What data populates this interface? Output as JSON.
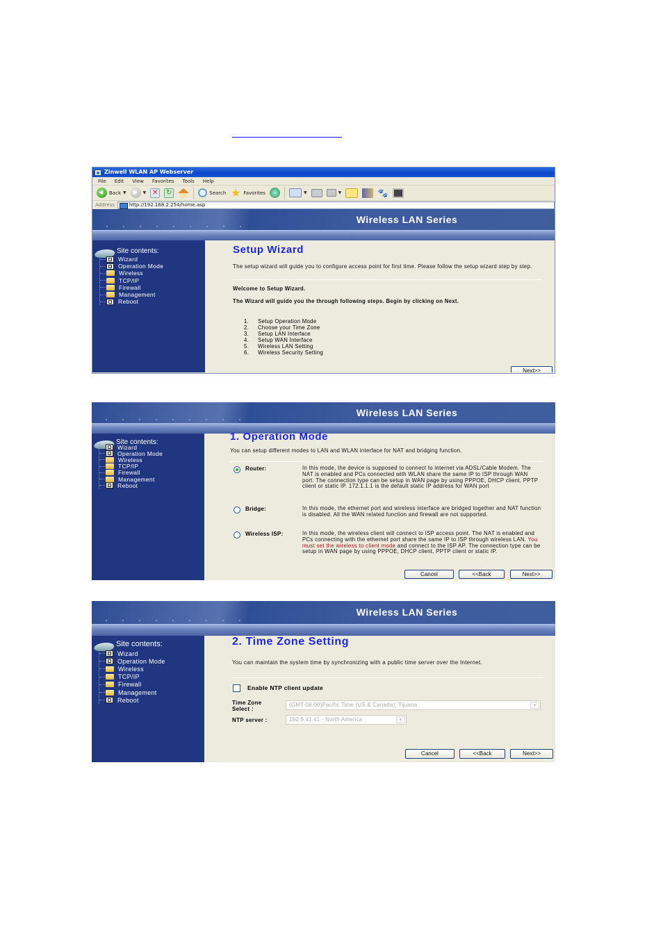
{
  "browser": {
    "window_title": "Zinwell WLAN AP Webserver",
    "menu": [
      "File",
      "Edit",
      "View",
      "Favorites",
      "Tools",
      "Help"
    ],
    "toolbar": {
      "back": "Back",
      "search": "Search",
      "favorites": "Favorites"
    },
    "address_label": "Address",
    "address_value": "http://192.168.2.254/home.asp"
  },
  "app": {
    "banner_title": "Wireless LAN Series",
    "sidebar": {
      "heading": "Site contents:",
      "items": [
        {
          "label": "Wizard",
          "icon": "page-icon"
        },
        {
          "label": "Operation Mode",
          "icon": "page-icon"
        },
        {
          "label": "Wireless",
          "icon": "folder-icon"
        },
        {
          "label": "TCP/IP",
          "icon": "folder-icon"
        },
        {
          "label": "Firewall",
          "icon": "folder-icon"
        },
        {
          "label": "Management",
          "icon": "folder-icon"
        },
        {
          "label": "Reboot",
          "icon": "page-icon"
        }
      ]
    }
  },
  "wizard": {
    "title": "Setup Wizard",
    "intro": "The setup wizard will guide you to configure access point for first time. Please follow the setup wizard step by step.",
    "welcome": "Welcome to Setup Wizard.",
    "guide": "The Wizard will guide you the through following steps. Begin by clicking on Next.",
    "steps": [
      {
        "num": "1.",
        "label": "Setup Operation Mode"
      },
      {
        "num": "2.",
        "label": "Choose your Time Zone"
      },
      {
        "num": "3.",
        "label": "Setup LAN Interface"
      },
      {
        "num": "4.",
        "label": "Setup WAN Interface"
      },
      {
        "num": "5.",
        "label": "Wireless LAN Setting"
      },
      {
        "num": "6.",
        "label": "Wireless Security Setting"
      }
    ],
    "next_label": "Next>>"
  },
  "operation_mode": {
    "title": "1. Operation Mode",
    "intro": "You can setup different modes to LAN and WLAN interface for NAT and bridging function.",
    "selected": "Router",
    "modes": [
      {
        "label": "Router:",
        "desc": "In this mode, the device is supposed to connect to internet via ADSL/Cable Modem. The NAT is enabled and PCs connected with WLAN share the same IP to ISP through WAN port. The connection type can be setup in WAN page by using PPPOE, DHCP client, PPTP client or static IP. 172.1.1.1 is the default static IP address for WAN port"
      },
      {
        "label": "Bridge:",
        "desc": "In this mode, the ethernet port and wireless interface are bridged together and NAT function is disabled. All the WAN related function and firewall are not supported."
      },
      {
        "label": "Wireless ISP:",
        "desc_before": "In this mode, the wireless client will connect to ISP access point. The NAT is enabled and PCs connecting with the ethernet port share the same IP to ISP through wireless LAN. ",
        "desc_warn": "You must set the wireless to client mode",
        "desc_after": " and connect to the ISP AP. The connection type can be setup in WAN page by using PPPOE, DHCP client, PPTP client or static IP."
      }
    ],
    "cancel_label": "Cancel",
    "back_label": "<<Back",
    "next_label": "Next>>"
  },
  "time_zone": {
    "title": "2. Time Zone Setting",
    "intro": "You can maintain the system time by synchronizing with a public time server over the Internet.",
    "ntp_checkbox_label": "Enable NTP client update",
    "ntp_enabled": false,
    "tz_label": "Time Zone Select :",
    "tz_value": "(GMT-08:00)Pacific Time (US & Canada); Tijuana",
    "ntp_server_label": "NTP server :",
    "ntp_server_value": "192.5.41.41 - North America",
    "cancel_label": "Cancel",
    "back_label": "<<Back",
    "next_label": "Next>>"
  },
  "colors": {
    "title_blue": "#1a27e6",
    "sidebar_bg": "#213680",
    "content_bg": "#ecebde",
    "warning_red": "#b01010"
  }
}
